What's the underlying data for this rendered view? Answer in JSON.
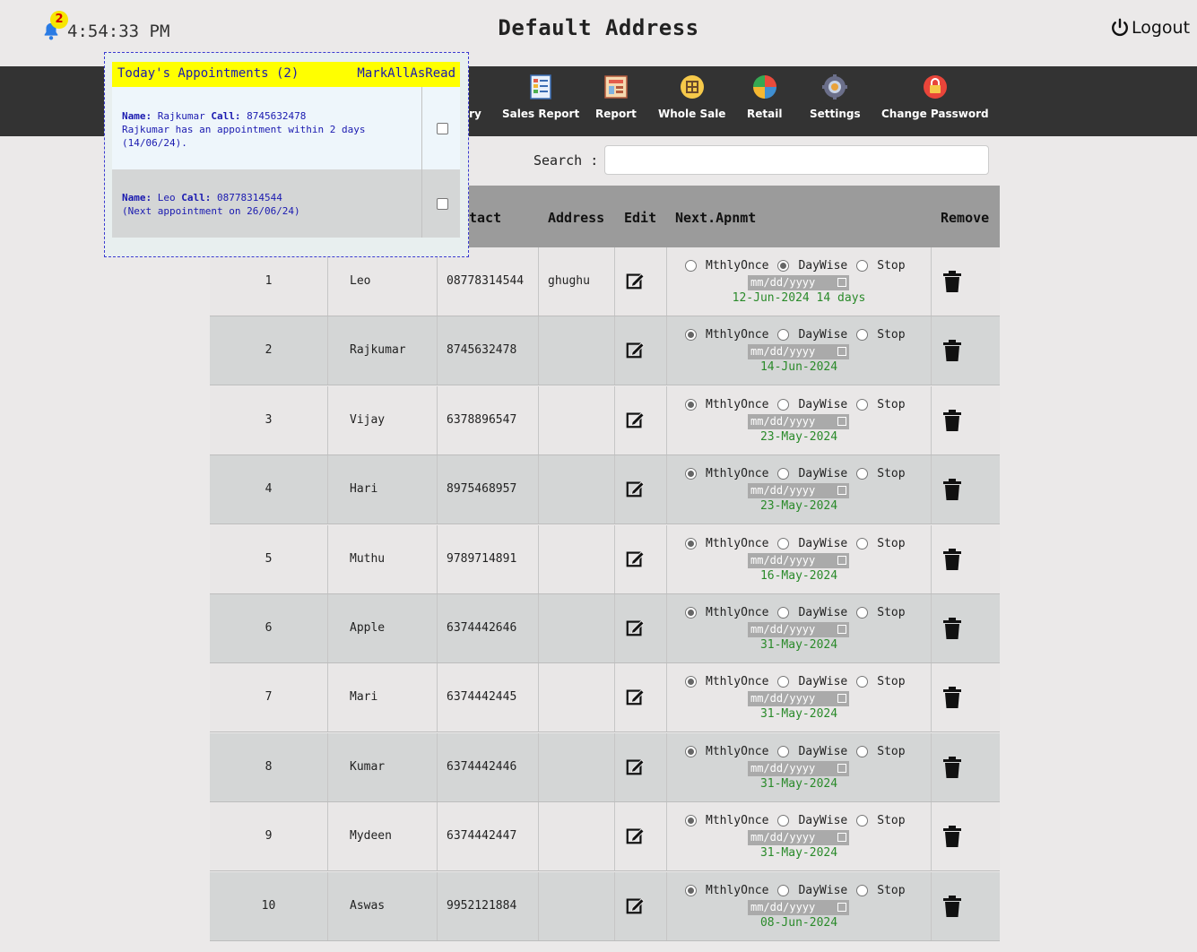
{
  "header": {
    "notification_count": "2",
    "time": "4:54:33 PM",
    "title": "Default Address",
    "logout_label": "Logout"
  },
  "nav": {
    "items": [
      {
        "label": "ry"
      },
      {
        "label": "Sales Report"
      },
      {
        "label": "Report"
      },
      {
        "label": "Whole Sale"
      },
      {
        "label": "Retail"
      },
      {
        "label": "Settings"
      },
      {
        "label": "Change Password"
      }
    ]
  },
  "search": {
    "label": "Search :",
    "value": "",
    "placeholder": ""
  },
  "table": {
    "headers": {
      "contact": "tact",
      "address": "Address",
      "edit": "Edit",
      "next": "Next.Apnmt",
      "remove": "Remove"
    },
    "radio_labels": {
      "monthly": "MthlyOnce",
      "daywise": "DayWise",
      "stop": "Stop"
    },
    "date_placeholder": "mm/dd/yyyy",
    "rows": [
      {
        "no": "1",
        "name": "Leo",
        "contact": "08778314544",
        "address": "ghughu",
        "next": "12-Jun-2024 14 days",
        "selected": "daywise"
      },
      {
        "no": "2",
        "name": "Rajkumar",
        "contact": "8745632478",
        "address": "",
        "next": "14-Jun-2024",
        "selected": "monthly"
      },
      {
        "no": "3",
        "name": "Vijay",
        "contact": "6378896547",
        "address": "",
        "next": "23-May-2024",
        "selected": "monthly"
      },
      {
        "no": "4",
        "name": "Hari",
        "contact": "8975468957",
        "address": "",
        "next": "23-May-2024",
        "selected": "monthly"
      },
      {
        "no": "5",
        "name": "Muthu",
        "contact": "9789714891",
        "address": "",
        "next": "16-May-2024",
        "selected": "monthly"
      },
      {
        "no": "6",
        "name": "Apple",
        "contact": "6374442646",
        "address": "",
        "next": "31-May-2024",
        "selected": "monthly"
      },
      {
        "no": "7",
        "name": "Mari",
        "contact": "6374442445",
        "address": "",
        "next": "31-May-2024",
        "selected": "monthly"
      },
      {
        "no": "8",
        "name": "Kumar",
        "contact": "6374442446",
        "address": "",
        "next": "31-May-2024",
        "selected": "monthly"
      },
      {
        "no": "9",
        "name": "Mydeen",
        "contact": "6374442447",
        "address": "",
        "next": "31-May-2024",
        "selected": "monthly"
      },
      {
        "no": "10",
        "name": "Aswas",
        "contact": "9952121884",
        "address": "",
        "next": "08-Jun-2024",
        "selected": "monthly"
      }
    ]
  },
  "popup": {
    "title": "Today's Appointments (2)",
    "mark_all": "MarkAllAsRead",
    "name_label": "Name:",
    "call_label": "Call:",
    "items": [
      {
        "name": "Rajkumar",
        "call": "8745632478",
        "line2": "Rajkumar has an appointment within 2 days",
        "line3": "(14/06/24)."
      },
      {
        "name": "Leo",
        "call": "08778314544",
        "line2": "(Next appointment on 26/06/24)",
        "line3": ""
      }
    ]
  },
  "colors": {
    "navbar": "#333333",
    "popup_header": "#ffff00",
    "next_date": "#2a8a2a",
    "table_header": "#9b9b9b"
  }
}
